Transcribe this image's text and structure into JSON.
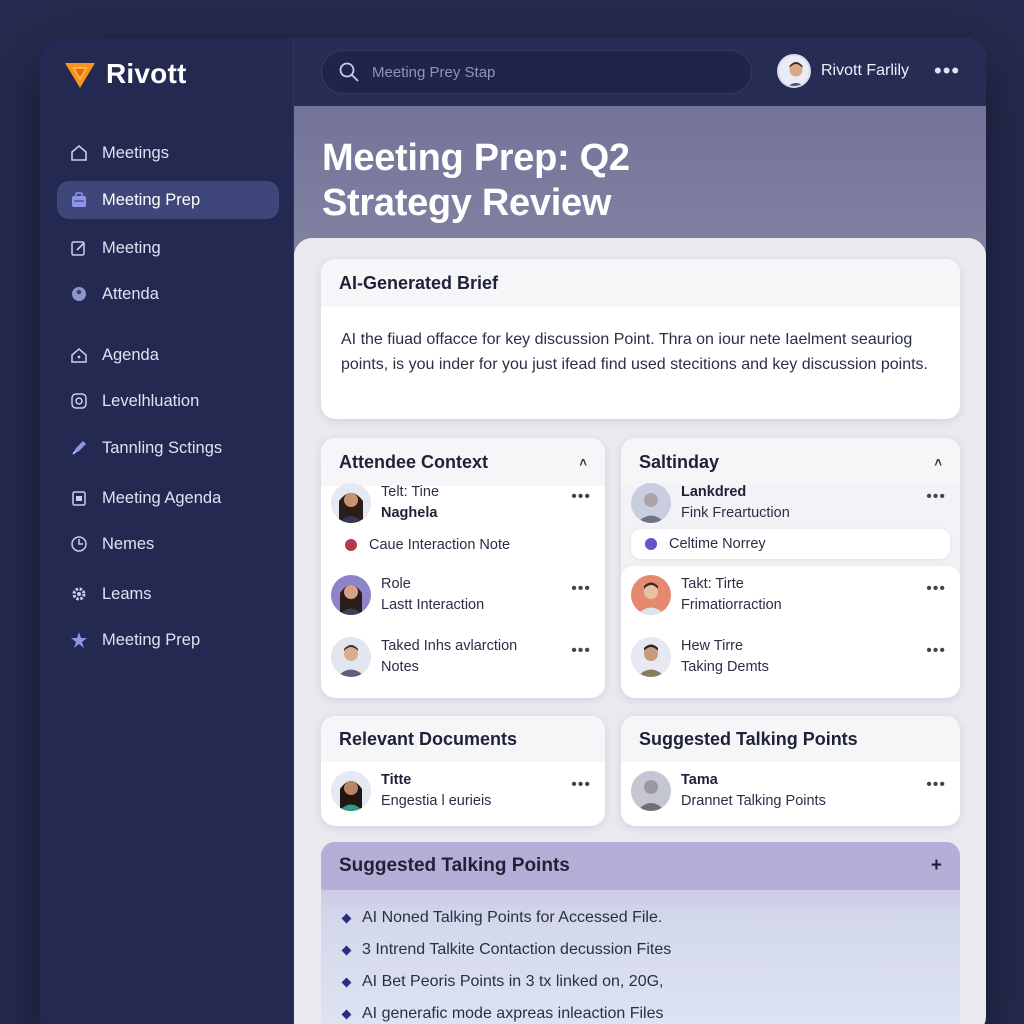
{
  "brand": {
    "name": "Rivott"
  },
  "sidebar": {
    "items": [
      {
        "label": "Meetings",
        "icon": "home-icon"
      },
      {
        "label": "Meeting Prep",
        "icon": "briefcase-icon",
        "active": true
      },
      {
        "label": "Meeting",
        "icon": "edit-icon"
      },
      {
        "label": "Attenda",
        "icon": "circle-icon"
      },
      {
        "label": "Agenda",
        "icon": "house-outline-icon"
      },
      {
        "label": "Levelhluation",
        "icon": "refresh-icon"
      },
      {
        "label": "Tannling Sctings",
        "icon": "rocket-icon"
      },
      {
        "label": "Meeting Agenda",
        "icon": "clipboard-icon"
      },
      {
        "label": "Nemes",
        "icon": "clock-icon"
      },
      {
        "label": "Leams",
        "icon": "gear-icon"
      },
      {
        "label": "Meeting Prep",
        "icon": "star-icon"
      }
    ]
  },
  "topbar": {
    "search_placeholder": "Meeting Prey Stap",
    "user_name": "Rivott Farlily",
    "more": "•••"
  },
  "page": {
    "title": "Meeting Prep: Q2 Strategy Review"
  },
  "brief": {
    "title": "AI-Generated Brief",
    "text": "AI the fiuad offacce for key discussion Point. Thra on iour nete Iaelment seauriog points, is you inder for you just ifead find used stecitions and key discussion points."
  },
  "attendee_context": {
    "title": "Attendee Context",
    "caret": "˄",
    "rows": [
      {
        "line1": "Telt: Tine",
        "line2": "Naghela"
      },
      {
        "line1": "Role",
        "line2": "Lastt Interaction"
      },
      {
        "line1": "Taked Inhs avlarction",
        "line2": "Notes"
      }
    ],
    "note": "Caue Interaction Note"
  },
  "saltinday": {
    "title": "Saltinday",
    "caret": "˄",
    "rows": [
      {
        "line1": "Lankdred",
        "line2": "Fink Freartuction"
      },
      {
        "line1": "Takt: Tirte",
        "line2": "Frimatiorraction"
      },
      {
        "line1": "Hew Tirre",
        "line2": "Taking Demts"
      }
    ],
    "note": "Celtime Norrey"
  },
  "relevant_documents": {
    "title": "Relevant Documents",
    "row": {
      "line1": "Titte",
      "line2": "Engestia l eurieis"
    }
  },
  "suggested_small": {
    "title": "Suggested Talking Points",
    "row": {
      "line1": "Tama",
      "line2": "Drannet Talking Points"
    }
  },
  "talking_points": {
    "title": "Suggested Talking Points",
    "add": "+",
    "items": [
      "AI Noned Talking Points for Accessed File.",
      "3 Intrend Talkite Contaction decussion Fites",
      "AI Bet Peoris Points in 3 tx linked on, 20G,",
      "AI generafic mode axpreas inleaction Files"
    ]
  },
  "colors": {
    "background": "#262b4f",
    "sidebar": "#232950",
    "active_nav": "#3f4679",
    "accent_orange": "#f7931e",
    "talking_points_header": "#b6aed7"
  }
}
